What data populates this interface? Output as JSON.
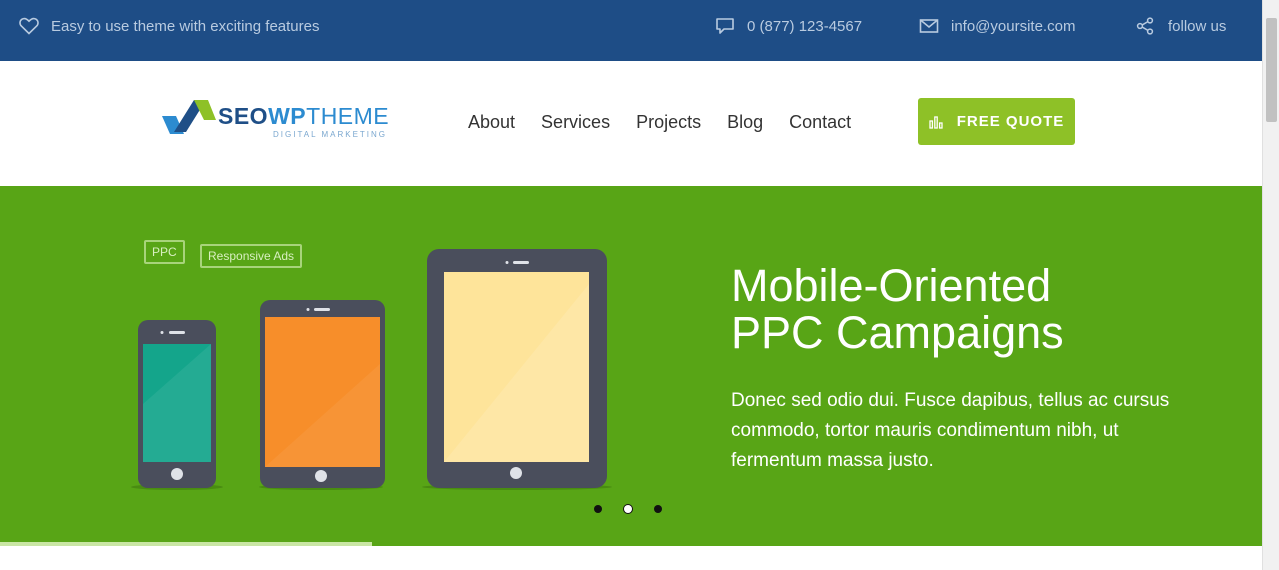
{
  "topbar": {
    "tagline": "Easy to use theme with exciting features",
    "phone": "0 (877) 123-4567",
    "email": "info@yoursite.com",
    "follow": "follow us",
    "icons": [
      "heart-icon",
      "chat-bubble-icon",
      "envelope-icon",
      "share-icon"
    ]
  },
  "logo": {
    "seo": "SEO",
    "wp": "WP",
    "theme": "THEME",
    "tagline": "DIGITAL MARKETING"
  },
  "nav": {
    "items": [
      "About",
      "Services",
      "Projects",
      "Blog",
      "Contact"
    ]
  },
  "quote_button": {
    "label": "FREE QUOTE",
    "icon": "bar-chart-icon"
  },
  "hero": {
    "tags": [
      "PPC",
      "Responsive Ads"
    ],
    "title_line1": "Mobile-Oriented",
    "title_line2": "PPC Campaigns",
    "text": "Donec sed odio dui. Fusce dapibus, tellus ac cursus commodo, tortor mauris condimentum nibh, ut fermentum massa justo.",
    "slides": 3,
    "active_slide": 2,
    "slide_progress": 0.295
  },
  "colors": {
    "topbar": "#1e4d86",
    "hero": "#58a516",
    "button": "#8ec127",
    "phone_screen": "#14a58b",
    "tablet_screen": "#f78e2a",
    "large_tablet_screen": "#fee49a",
    "device_body": "#4a4e5c"
  }
}
